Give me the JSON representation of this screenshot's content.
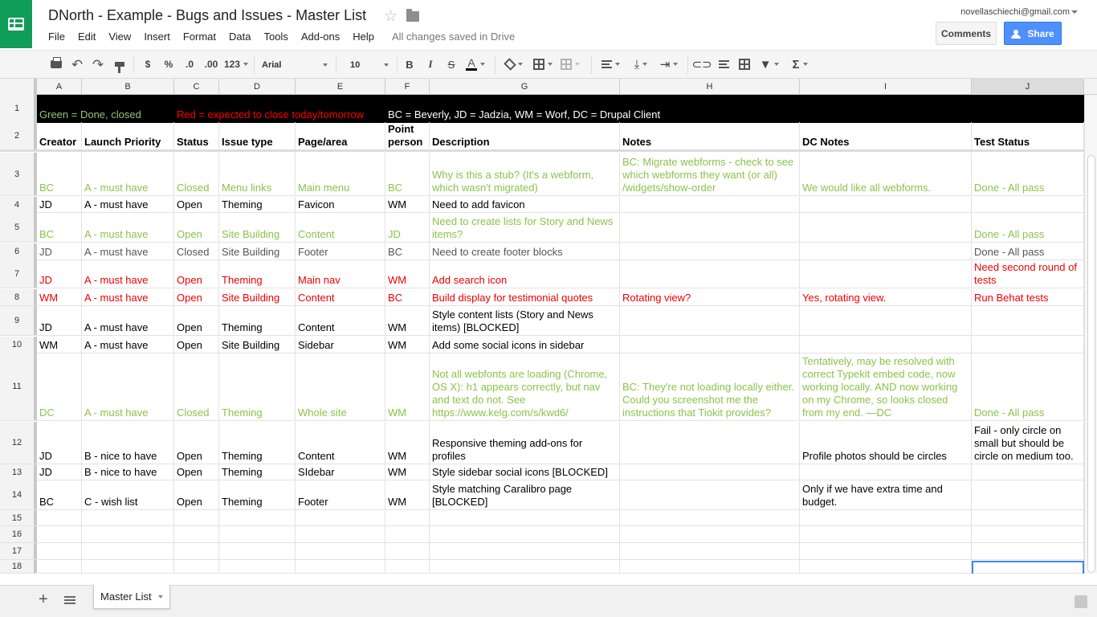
{
  "header": {
    "title": "DNorth - Example - Bugs and Issues - Master List",
    "save_status": "All changes saved in Drive",
    "account_email": "novellaschiechi@gmail.com",
    "comments_label": "Comments",
    "share_label": "Share",
    "menu": [
      "File",
      "Edit",
      "View",
      "Insert",
      "Format",
      "Data",
      "Tools",
      "Add-ons",
      "Help"
    ]
  },
  "toolbar": {
    "currency": "$",
    "percent": "%",
    "decrease_decimals": ".0",
    "increase_decimals": ".00",
    "more_formats": "123",
    "font": "Arial",
    "font_size": "10",
    "bold": "B",
    "italic": "I",
    "strike": "S",
    "text_color": "A",
    "sum": "Σ"
  },
  "grid": {
    "columns": [
      "A",
      "B",
      "C",
      "D",
      "E",
      "F",
      "G",
      "H",
      "I",
      "J"
    ],
    "row_numbers": [
      "1",
      "2",
      "3",
      "4",
      "5",
      "6",
      "7",
      "8",
      "9",
      "10",
      "11",
      "12",
      "13",
      "14",
      "15",
      "16",
      "17",
      "18"
    ],
    "legend": {
      "green": "Green = Done, closed",
      "red": "Red = expected to close today/tomorrow",
      "initials": "BC = Beverly, JD = Jadzia, WM = Worf, DC = Drupal Client"
    },
    "headers": [
      "Creator",
      "Launch Priority",
      "Status",
      "Issue type",
      "Page/area",
      "Point person",
      "Description",
      "Notes",
      "DC Notes",
      "Test Status"
    ],
    "rows": [
      {
        "style": "green",
        "cells": [
          "BC",
          "A - must have",
          "Closed",
          "Menu links",
          "Main menu",
          "BC",
          "Why is this a stub? (It's a webform, which wasn't migrated)",
          "BC: Migrate webforms - check to see which webforms they want (or all) /widgets/show-order",
          "We would like all webforms.",
          "Done - All pass"
        ]
      },
      {
        "style": "black",
        "cells": [
          "JD",
          "A - must have",
          "Open",
          "Theming",
          "Favicon",
          "WM",
          "Need to add favicon",
          "",
          "",
          ""
        ]
      },
      {
        "style": "green",
        "cells": [
          "BC",
          "A - must have",
          "Open",
          "Site Building",
          "Content",
          "JD",
          "Need to create lists for Story and News items?",
          "",
          "",
          "Done - All pass"
        ]
      },
      {
        "style": "grey",
        "cells": [
          "JD",
          "A - must have",
          "Closed",
          "Site Building",
          "Footer",
          "BC",
          "Need to create footer blocks",
          "",
          "",
          "Done - All pass"
        ]
      },
      {
        "style": "red",
        "cells": [
          "JD",
          "A - must have",
          "Open",
          "Theming",
          "Main nav",
          "WM",
          "Add search icon",
          "",
          "",
          "Need second round of tests"
        ]
      },
      {
        "style": "red",
        "cells": [
          "WM",
          "A - must have",
          "Open",
          "Site Building",
          "Content",
          "BC",
          "Build display for testimonial quotes",
          "Rotating view?",
          "Yes, rotating view.",
          "Run Behat tests"
        ]
      },
      {
        "style": "black",
        "cells": [
          "JD",
          "A - must have",
          "Open",
          "Theming",
          "Content",
          "WM",
          "Style content lists (Story and News items) [BLOCKED]",
          "",
          "",
          ""
        ]
      },
      {
        "style": "black",
        "cells": [
          "WM",
          "A - must have",
          "Open",
          "Site Building",
          "Sidebar",
          "WM",
          "Add some social icons in sidebar",
          "",
          "",
          ""
        ]
      },
      {
        "style": "green",
        "cells": [
          "DC",
          "A - must have",
          "Closed",
          "Theming",
          "Whole site",
          "WM",
          "Not all webfonts are loading (Chrome, OS X): h1 appears correctly, but nav and text do not. See https://www.kelg.com/s/kwd6/",
          "BC: They're not loading locally either. Could you screenshot me the instructions that Tiokit provides?",
          "Tentatively, may be resolved with correct Typekit embed code, now working locally. AND now working on my Chrome, so looks closed from my end. —DC",
          "Done - All pass"
        ]
      },
      {
        "style": "black",
        "cells": [
          "JD",
          "B - nice to have",
          "Open",
          "Theming",
          "Content",
          "WM",
          "Responsive theming add-ons for profiles",
          "",
          "Profile photos should be circles",
          "Fail - only circle on small but should be circle on medium too."
        ]
      },
      {
        "style": "black",
        "cells": [
          "JD",
          "B - nice to have",
          "Open",
          "Theming",
          "SIdebar",
          "WM",
          "Style sidebar social icons [BLOCKED]",
          "",
          "",
          ""
        ]
      },
      {
        "style": "black",
        "cells": [
          "BC",
          "C - wish list",
          "Open",
          "Theming",
          "Footer",
          "WM",
          "Style matching Caralibro page [BLOCKED]",
          "",
          "Only if we have extra time and budget.",
          ""
        ]
      }
    ]
  },
  "sheets": {
    "active_tab": "Master List"
  },
  "colors": {
    "brand_green": "#0f9d58",
    "share_blue": "#4d90fe",
    "done_green": "#8bc34a",
    "due_red": "#ee0000",
    "selection_blue": "#4285f4"
  },
  "icons": [
    "sheets-logo-icon",
    "star-icon",
    "folder-icon",
    "print-icon",
    "undo-icon",
    "redo-icon",
    "paint-format-icon",
    "fill-color-icon",
    "borders-icon",
    "merge-icon",
    "align-icon",
    "valign-icon",
    "wrap-icon",
    "link-icon",
    "comment-icon",
    "chart-icon",
    "filter-icon",
    "functions-icon",
    "add-sheet-icon",
    "sheet-list-icon",
    "explore-icon"
  ]
}
